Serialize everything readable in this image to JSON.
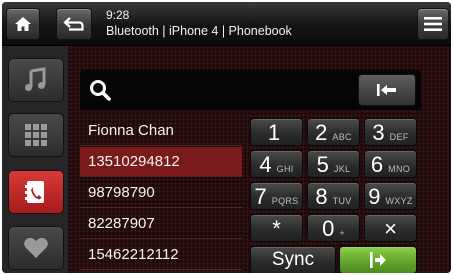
{
  "header": {
    "time": "9:28",
    "subtitle": "Bluetooth | iPhone 4 | Phonebook",
    "home_icon": "home-icon",
    "back_icon": "back-arrow-icon",
    "menu_icon": "menu-icon"
  },
  "sidebar": {
    "items": [
      {
        "name": "music",
        "icon": "music-note-icon"
      },
      {
        "name": "apps",
        "icon": "grid-icon"
      },
      {
        "name": "phone",
        "icon": "phonebook-icon",
        "active": true
      },
      {
        "name": "favorites",
        "icon": "heart-icon"
      }
    ]
  },
  "search": {
    "value": "",
    "clear_icon": "backspace-icon"
  },
  "results": [
    "Fionna Chan",
    "13510294812",
    "98798790",
    "82287907",
    "15462212112"
  ],
  "selected_index": 1,
  "keypad": {
    "keys": [
      {
        "digit": "1",
        "letters": ""
      },
      {
        "digit": "2",
        "letters": "ABC"
      },
      {
        "digit": "3",
        "letters": "DEF"
      },
      {
        "digit": "4",
        "letters": "GHI"
      },
      {
        "digit": "5",
        "letters": "JKL"
      },
      {
        "digit": "6",
        "letters": "MNO"
      },
      {
        "digit": "7",
        "letters": "PQRS"
      },
      {
        "digit": "8",
        "letters": "TUV"
      },
      {
        "digit": "9",
        "letters": "WXYZ"
      },
      {
        "digit": "*",
        "letters": ""
      },
      {
        "digit": "0",
        "letters": "+"
      },
      {
        "digit": "×",
        "letters": ""
      }
    ],
    "sync_label": "Sync",
    "call_icon": "call-icon"
  },
  "colors": {
    "accent_red": "#c62828",
    "call_green": "#6fb434"
  }
}
